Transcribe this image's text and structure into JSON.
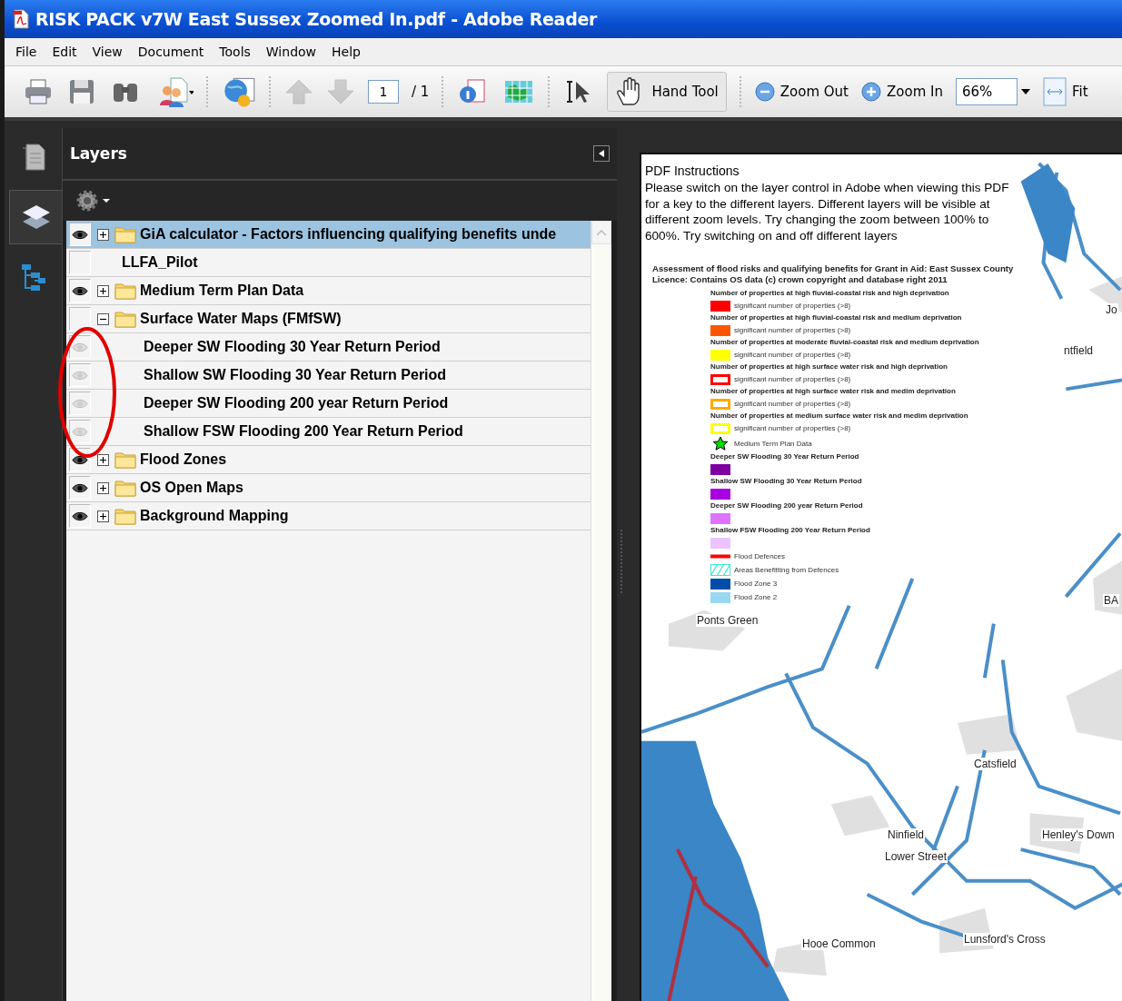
{
  "window": {
    "title": "RISK PACK v7W East Sussex Zoomed In.pdf - Adobe Reader"
  },
  "menu": [
    "File",
    "Edit",
    "View",
    "Document",
    "Tools",
    "Window",
    "Help"
  ],
  "toolbar": {
    "nav_buttons": [
      {
        "disabled": true
      },
      {
        "disabled": true
      }
    ],
    "page": "1",
    "page_total": "/ 1",
    "hand_tool": {
      "label": "Hand Tool",
      "selected": true
    },
    "zoom_out": "Zoom Out",
    "zoom_in": "Zoom In",
    "zoom": "66%",
    "fit": "Fit"
  },
  "sidebar": {
    "tabs": [
      {
        "selected": false
      },
      {
        "selected": true
      },
      {
        "selected": false
      }
    ]
  },
  "layers": {
    "title": "Layers",
    "items": [
      {
        "kind": "folder",
        "label": "GiA calculator - Factors influencing qualifying benefits unde",
        "visible": true,
        "expanded": false,
        "selected": true
      },
      {
        "kind": "layer",
        "label": "LLFA_Pilot",
        "visible": false,
        "selected": false
      },
      {
        "kind": "folder",
        "label": "Medium Term Plan Data",
        "visible": true,
        "expanded": false,
        "selected": false
      },
      {
        "kind": "folder",
        "label": "Surface Water Maps (FMfSW)",
        "visible": false,
        "expanded": true,
        "selected": false,
        "children": [
          {
            "kind": "layer",
            "label": "Deeper SW Flooding 30 Year Return Period",
            "visible": true,
            "selected": false
          },
          {
            "kind": "layer",
            "label": "Shallow SW Flooding 30 Year Return Period",
            "visible": true,
            "selected": false
          },
          {
            "kind": "layer",
            "label": "Deeper SW Flooding 200 year Return Period",
            "visible": true,
            "selected": false
          },
          {
            "kind": "layer",
            "label": "Shallow FSW Flooding 200 Year Return Period",
            "visible": true,
            "selected": false
          }
        ]
      },
      {
        "kind": "folder",
        "label": "Flood Zones",
        "visible": true,
        "expanded": false,
        "selected": false
      },
      {
        "kind": "folder",
        "label": "OS Open Maps",
        "visible": true,
        "expanded": false,
        "selected": false
      },
      {
        "kind": "folder",
        "label": "Background Mapping",
        "visible": true,
        "expanded": false,
        "selected": false
      }
    ]
  },
  "document": {
    "instructions_title": "PDF Instructions",
    "instructions": "Please switch on the layer control in Adobe when viewing this PDF for a key to the different layers. Different layers will be visible at different zoom levels. Try changing the zoom between 100% to 600%. Try switching on and off different layers",
    "legend": {
      "title": "Assessment of flood risks and qualifying benefits for Grant in Aid: East Sussex County",
      "license": "Licence: Contains OS data (c) crown copyright and database right 2011",
      "items": [
        {
          "kind": "heading",
          "label": "Number of properties at high fluvial-coastal risk and high deprivation"
        },
        {
          "kind": "fill",
          "color": "#ff0000",
          "label": "significant number of properties (>8)"
        },
        {
          "kind": "heading",
          "label": "Number of properties at high fluvial-coastal risk and medium deprivation"
        },
        {
          "kind": "fill",
          "color": "#ff5500",
          "label": "significant number of properties (>8)"
        },
        {
          "kind": "heading",
          "label": "Number of properties at moderate fluvial-coastal risk and medium deprivation"
        },
        {
          "kind": "fill",
          "color": "#ffff00",
          "label": "significant number of properties (>8)"
        },
        {
          "kind": "heading",
          "label": "Number of properties at high surface water risk and high deprivation"
        },
        {
          "kind": "outline",
          "color": "#ff0000",
          "label": "significant number of properties (>8)"
        },
        {
          "kind": "heading",
          "label": "Number of properties at high surface water risk and medim deprivation"
        },
        {
          "kind": "outline",
          "color": "#ffaa00",
          "label": "significant number of properties (>8)"
        },
        {
          "kind": "heading",
          "label": "Number of properties at medium surface water risk and medim deprivation"
        },
        {
          "kind": "outline",
          "color": "#ffff00",
          "label": "significant number of properties (>8)"
        },
        {
          "kind": "star",
          "color": "#00dd00",
          "label": "Medium Term Plan Data"
        },
        {
          "kind": "heading",
          "label": "Deeper SW Flooding 30 Year Return Period"
        },
        {
          "kind": "fill",
          "color": "#7f00a0"
        },
        {
          "kind": "heading",
          "label": "Shallow SW Flooding 30 Year Return Period"
        },
        {
          "kind": "fill",
          "color": "#a800e0"
        },
        {
          "kind": "heading",
          "label": "Deeper SW Flooding 200 year Return Period"
        },
        {
          "kind": "fill",
          "color": "#df73ff"
        },
        {
          "kind": "heading",
          "label": "Shallow FSW Flooding 200 Year Return Period"
        },
        {
          "kind": "fill",
          "color": "#ebc4ff"
        },
        {
          "kind": "line",
          "color": "#ff0000",
          "label": "Flood Defences"
        },
        {
          "kind": "hatch",
          "color": "#44e8d0",
          "label": "Areas Benefitting from Defences"
        },
        {
          "kind": "fill",
          "color": "#004da8",
          "label": "Flood Zone 3"
        },
        {
          "kind": "fill",
          "color": "#99d6f0",
          "label": "Flood Zone 2"
        }
      ]
    },
    "map_labels": [
      "Jo",
      "ntfield",
      "Ponts Green",
      "BA",
      "Catsfield",
      "Ninfield",
      "Lower Street",
      "Henley's Down",
      "Hooe Common",
      "Lunsford's Cross"
    ]
  }
}
